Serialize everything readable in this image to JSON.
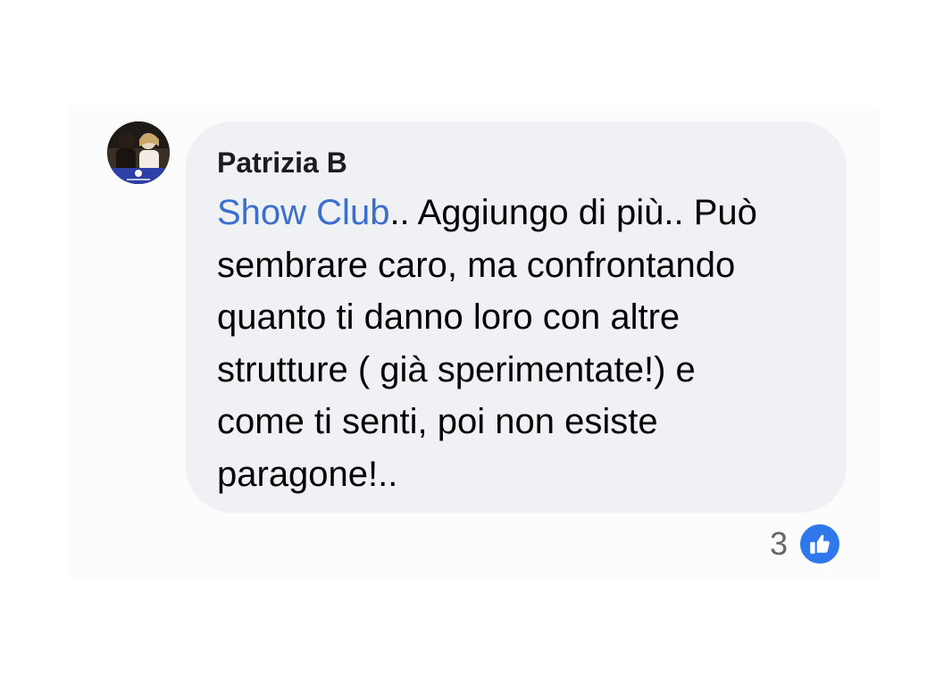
{
  "comment": {
    "author": "Patrizia B",
    "mention": "Show Club",
    "lines": [
      ".. Aggiungo di più.. Può",
      "sembrare caro, ma confrontando",
      "quanto ti danno loro con altre",
      "strutture ( già sperimentate!) e",
      "come ti senti, poi non esiste",
      "paragone!.."
    ],
    "reaction_count": "3",
    "reaction_icon": "like-thumbs-up-icon"
  },
  "colors": {
    "bubble": "#f0f1f5",
    "mention": "#3b6fce",
    "like": "#2f78ec"
  }
}
